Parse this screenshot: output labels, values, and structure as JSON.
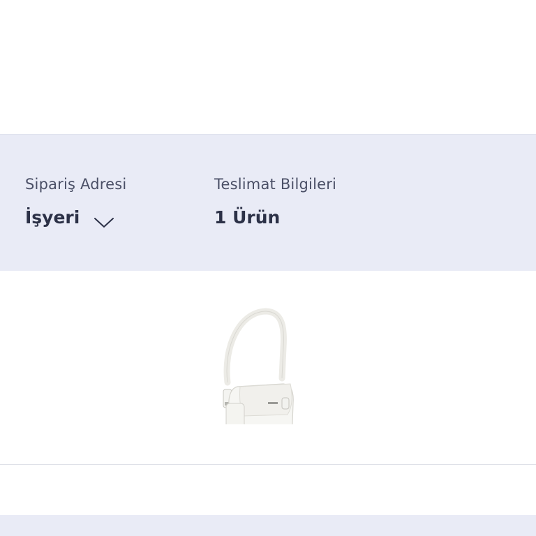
{
  "summary": {
    "address_label": "Sipariş Adresi",
    "address_value": "İşyeri",
    "delivery_label": "Teslimat Bilgileri",
    "delivery_value": "1 Ürün"
  },
  "product": {
    "image_icon": "white-shoulder-bag"
  },
  "colors": {
    "band_background": "#e9ebf6",
    "text_dark": "#2c3147",
    "text_muted": "#4a4f66"
  }
}
